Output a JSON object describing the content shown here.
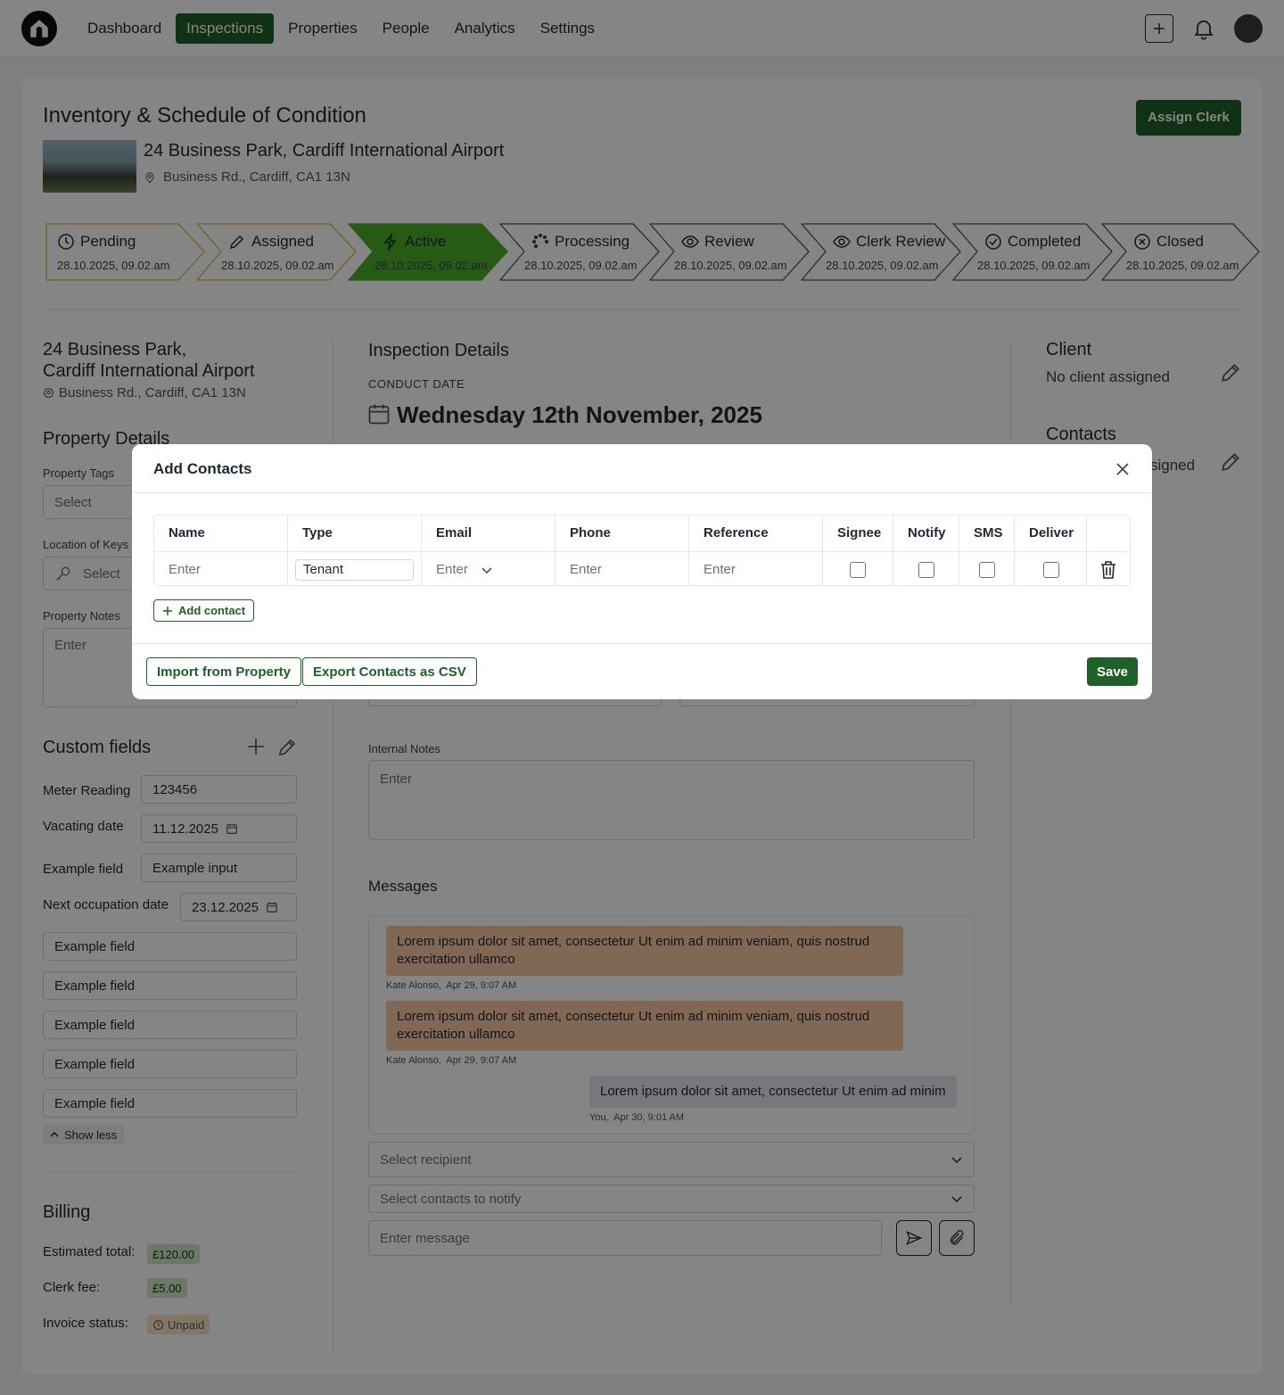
{
  "nav": {
    "items": [
      "Dashboard",
      "Inspections",
      "Properties",
      "People",
      "Analytics",
      "Settings"
    ],
    "active": "Inspections"
  },
  "header": {
    "title": "Inventory & Schedule of Condition",
    "assign_label": "Assign Clerk",
    "address_line": "24 Business Park, Cardiff International Airport",
    "address_sub": "Business Rd., Cardiff, CA1 13N"
  },
  "stages": [
    {
      "label": "Pending",
      "date": "28.10.2025, 09.02.am",
      "icon": "clock-icon",
      "state": "done"
    },
    {
      "label": "Assigned",
      "date": "28.10.2025, 09.02.am",
      "icon": "pencil-icon",
      "state": "done"
    },
    {
      "label": "Active",
      "date": "28.10.2025, 09.02.am",
      "icon": "lightning-icon",
      "state": "current"
    },
    {
      "label": "Processing",
      "date": "28.10.2025, 09.02.am",
      "icon": "loader-icon",
      "state": "todo"
    },
    {
      "label": "Review",
      "date": "28.10.2025, 09.02.am",
      "icon": "eye-icon",
      "state": "todo"
    },
    {
      "label": "Clerk Review",
      "date": "28.10.2025, 09.02.am",
      "icon": "eye-icon",
      "state": "todo"
    },
    {
      "label": "Completed",
      "date": "28.10.2025, 09.02.am",
      "icon": "check-circle-icon",
      "state": "todo"
    },
    {
      "label": "Closed",
      "date": "28.10.2025, 09.02.am",
      "icon": "x-circle-icon",
      "state": "todo"
    }
  ],
  "left": {
    "address_l1": "24 Business Park,",
    "address_l2": "Cardiff International Airport",
    "address_sub": "Business Rd., Cardiff, CA1 13N",
    "property_details": "Property Details",
    "tags_label": "Property Tags",
    "tags_placeholder": "Select",
    "keys_label": "Location of Keys",
    "keys_placeholder": "Select",
    "notes_label": "Property Notes",
    "notes_placeholder": "Enter",
    "custom_fields": "Custom fields",
    "fields": [
      {
        "label": "Meter Reading",
        "value": "123456"
      },
      {
        "label": "Vacating date",
        "value": "11.12.2025"
      },
      {
        "label": "Example field",
        "value": "Example input"
      },
      {
        "label": "Next occupation date",
        "value": "23.12.2025"
      }
    ],
    "extra_fields": [
      "Example field",
      "Example field",
      "Example field",
      "Example field",
      "Example field"
    ],
    "show_less": "Show less",
    "billing": "Billing",
    "est_label": "Estimated total:",
    "est_value": "£120.00",
    "fee_label": "Clerk fee:",
    "fee_value": "£5.00",
    "inv_label": "Invoice status:",
    "inv_value": "Unpaid"
  },
  "middle": {
    "title": "Inspection Details",
    "conduct_label": "CONDUCT DATE",
    "conduct_date": "Wednesday 12th November, 2025",
    "internal_notes_label": "Internal Notes",
    "internal_notes_placeholder": "Enter",
    "messages_title": "Messages",
    "messages": [
      {
        "text": "Lorem ipsum dolor sit amet, consectetur Ut enim ad minim veniam, quis nostrud exercitation ullamco",
        "author": "Kate Alonso,",
        "time": "Apr 29, 9:07 AM"
      },
      {
        "text": "Lorem ipsum dolor sit amet, consectetur Ut enim ad minim veniam, quis nostrud exercitation ullamco",
        "author": "Kate Alonso,",
        "time": "Apr 29, 9:07 AM"
      },
      {
        "text": "Lorem ipsum dolor sit amet, consectetur Ut enim ad minim",
        "author": "You,",
        "time": "Apr 30, 9:01 AM"
      }
    ],
    "recipient_placeholder": "Select recipient",
    "notify_placeholder": "Select contacts to notify",
    "message_placeholder": "Enter message"
  },
  "right": {
    "client_title": "Client",
    "client_value": "No client assigned",
    "contacts_title": "Contacts",
    "contacts_value": "signed"
  },
  "modal": {
    "title": "Add Contacts",
    "columns": [
      "Name",
      "Type",
      "Email",
      "Phone",
      "Reference",
      "Signee",
      "Notify",
      "SMS",
      "Deliver"
    ],
    "row": {
      "name": "Enter",
      "type": "Tenant",
      "email": "Enter",
      "phone": "Enter",
      "reference": "Enter"
    },
    "add_contact": "Add contact",
    "import_label": "Import from Property",
    "export_label": "Export Contacts as CSV",
    "save_label": "Save"
  },
  "colors": {
    "brand": "#1f5f28",
    "active_stage": "#4caf2a",
    "done_stage": "#e5b640",
    "bubble_other": "#f6c8a1",
    "bubble_self": "#e5e7eb"
  }
}
